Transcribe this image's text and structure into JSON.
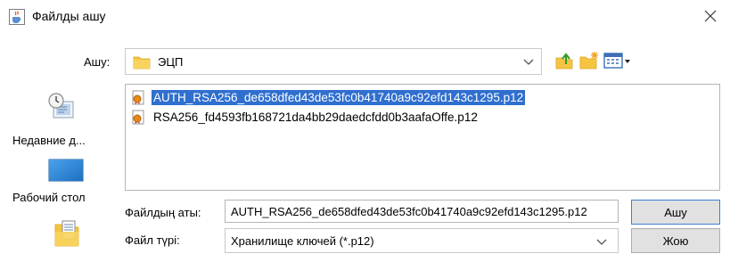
{
  "window": {
    "title": "Файлды ашу",
    "app_icon": "java-cup-icon",
    "close_icon": "close-icon"
  },
  "location": {
    "label": "Ашу:",
    "value": "ЭЦП",
    "folder_icon": "folder-icon",
    "toolbar": {
      "up_icon": "up-one-level-icon",
      "new_folder_icon": "new-folder-icon",
      "view_icon": "view-menu-icon"
    }
  },
  "places": [
    {
      "label": "Недавние д...",
      "icon": "recent-items-icon"
    },
    {
      "label": "Рабочий стол",
      "icon": "desktop-icon"
    },
    {
      "label": "",
      "icon": "documents-icon"
    }
  ],
  "files": [
    {
      "name": "AUTH_RSA256_de658dfed43de53fc0b41740a9c92efd143c1295.p12",
      "selected": true,
      "icon": "certificate-file-icon"
    },
    {
      "name": "RSA256_fd4593fb168721da4bb29daedcfdd0b3aafaOffe.p12",
      "selected": false,
      "icon": "certificate-file-icon"
    }
  ],
  "filename": {
    "label": "Файлдың аты:",
    "value": "AUTH_RSA256_de658dfed43de53fc0b41740a9c92efd143c1295.p12"
  },
  "filetype": {
    "label": "Файл түрі:",
    "value": "Хранилище ключей (*.p12)"
  },
  "buttons": {
    "open": "Ашу",
    "cancel": "Жою"
  },
  "colors": {
    "selection": "#2f6fcf",
    "folder": "#f5c542",
    "desktop": "#2e86d6"
  }
}
